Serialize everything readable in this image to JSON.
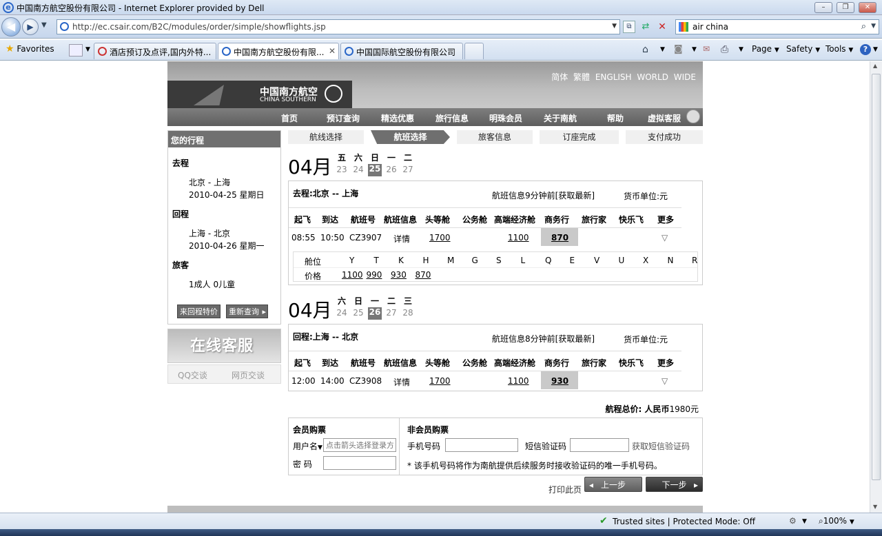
{
  "window": {
    "title": "中国南方航空股份有限公司 - Internet Explorer provided by Dell"
  },
  "address": {
    "url": "http://ec.csair.com/B2C/modules/order/simple/showflights.jsp"
  },
  "search": {
    "value": "air china"
  },
  "favorites_label": "Favorites",
  "tabs": [
    {
      "label": "酒店预订及点评,国内外特..."
    },
    {
      "label": "中国南方航空股份有限..."
    },
    {
      "label": "中国国际航空股份有限公司"
    }
  ],
  "toolbar": {
    "page": "Page",
    "safety": "Safety",
    "tools": "Tools"
  },
  "status": {
    "zone": "Trusted sites | Protected Mode: Off",
    "zoom": "100%"
  },
  "site": {
    "languages": "简体  繁體  ENGLISH  WORLD WIDE",
    "logo_cn": "中国南方航空",
    "logo_en": "CHINA SOUTHERN",
    "menu": [
      "首页",
      "预订查询",
      "精选优惠",
      "旅行信息",
      "明珠会员",
      "关于南航",
      "帮助",
      "虚拟客服"
    ]
  },
  "sidebar": {
    "title": "您的行程",
    "outbound_label": "去程",
    "outbound_route": "北京 - 上海",
    "outbound_date": "2010-04-25 星期日",
    "return_label": "回程",
    "return_route": "上海 - 北京",
    "return_date": "2010-04-26 星期一",
    "pax_label": "旅客",
    "pax_value": "1成人 0儿童",
    "btn_roundtrip": "来回程特价",
    "btn_requery": "重新查询",
    "online_service": "在线客服",
    "qq_chat": "QQ交谈",
    "web_chat": "网页交谈"
  },
  "steps": [
    "航线选择",
    "航班选择",
    "旅客信息",
    "订座完成",
    "支付成功"
  ],
  "outbound": {
    "month": "04月",
    "weekdays": [
      "五",
      "六",
      "日",
      "一",
      "二"
    ],
    "days": [
      "23",
      "24",
      "25",
      "26",
      "27"
    ],
    "route": "去程:北京 -- 上海",
    "info": "航班信息9分钟前[获取最新]",
    "currency": "货币单位:元",
    "headers": [
      "起飞",
      "到达",
      "航班号",
      "航班信息",
      "头等舱",
      "公务舱",
      "高端经济舱",
      "商务行",
      "旅行家",
      "快乐飞",
      "更多"
    ],
    "row": {
      "dep": "08:55",
      "arr": "10:50",
      "flight": "CZ3907",
      "info": "详情",
      "first": "1700",
      "premium": "1100",
      "business": "870"
    },
    "cabin_label": "舱位",
    "cabins": [
      "Y",
      "T",
      "K",
      "H",
      "M",
      "G",
      "S",
      "L",
      "Q",
      "E",
      "V",
      "U",
      "X",
      "N",
      "R"
    ],
    "price_label": "价格",
    "prices": [
      "1100",
      "990",
      "930",
      "870"
    ]
  },
  "return": {
    "month": "04月",
    "weekdays": [
      "六",
      "日",
      "一",
      "二",
      "三"
    ],
    "days": [
      "24",
      "25",
      "26",
      "27",
      "28"
    ],
    "route": "回程:上海 -- 北京",
    "info": "航班信息8分钟前[获取最新]",
    "currency": "货币单位:元",
    "row": {
      "dep": "12:00",
      "arr": "14:00",
      "flight": "CZ3908",
      "info": "详情",
      "first": "1700",
      "premium": "1100",
      "business": "930"
    }
  },
  "total": {
    "label": "航程总价: 人民币",
    "value": "1980元"
  },
  "member": {
    "title": "会员购票",
    "user_label": "用户名",
    "user_placeholder": "点击箭头选择登录方式",
    "pwd_label": "密 码"
  },
  "nonmember": {
    "title": "非会员购票",
    "phone_label": "手机号码",
    "sms_label": "短信验证码",
    "get_sms": "获取短信验证码",
    "note": "* 该手机号码将作为南航提供后续服务时接收验证码的唯一手机号码。"
  },
  "actions": {
    "print": "打印此页",
    "prev": "上一步",
    "next": "下一步"
  }
}
